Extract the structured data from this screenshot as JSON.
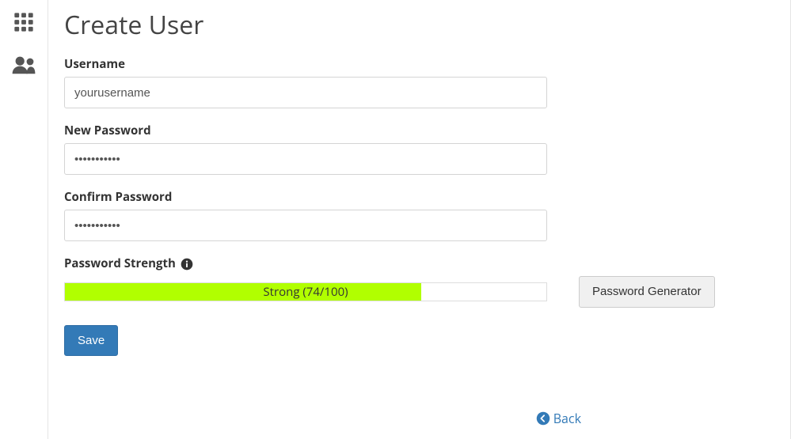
{
  "sidebar": {
    "items": [
      {
        "name": "apps-grid-icon"
      },
      {
        "name": "users-icon"
      }
    ]
  },
  "page": {
    "title": "Create User"
  },
  "form": {
    "username_label": "Username",
    "username_value": "yourusername",
    "new_password_label": "New Password",
    "new_password_value": "•••••••••••",
    "confirm_password_label": "Confirm Password",
    "confirm_password_value": "•••••••••••",
    "strength_label": "Password Strength",
    "strength_text": "Strong (74/100)",
    "strength_percent": 74,
    "password_generator_label": "Password Generator",
    "save_label": "Save"
  },
  "nav": {
    "back_label": "Back"
  },
  "colors": {
    "primary": "#337ab7",
    "strength_fill": "#b1ff00"
  }
}
